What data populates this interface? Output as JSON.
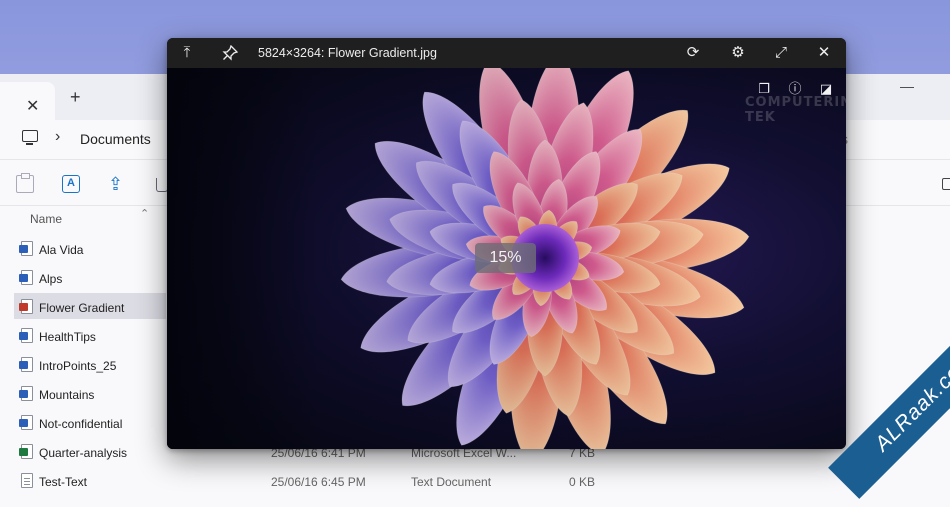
{
  "explorer": {
    "tab": {
      "close_glyph": "✕",
      "add_glyph": "+"
    },
    "window_minimize_glyph": "—",
    "breadcrumb": {
      "chevron": "›",
      "current": "Documents"
    },
    "search_ghost_text": "s",
    "toolbar": {
      "rename_glyph": "A",
      "share_glyph": "⇪"
    },
    "list": {
      "column_name": "Name",
      "sort_glyph": "⌃",
      "rows": [
        {
          "name": "Ala Vida",
          "type_icon": "word-doc-icon",
          "date": "",
          "kind": "",
          "size": ""
        },
        {
          "name": "Alps",
          "type_icon": "word-doc-icon",
          "date": "",
          "kind": "",
          "size": ""
        },
        {
          "name": "Flower Gradient",
          "type_icon": "pdf-icon",
          "date": "",
          "kind": "",
          "size": ""
        },
        {
          "name": "HealthTips",
          "type_icon": "word-doc-icon",
          "date": "",
          "kind": "",
          "size": ""
        },
        {
          "name": "IntroPoints_25",
          "type_icon": "word-doc-icon",
          "date": "",
          "kind": "",
          "size": ""
        },
        {
          "name": "Mountains",
          "type_icon": "word-doc-icon",
          "date": "",
          "kind": "",
          "size": ""
        },
        {
          "name": "Not-confidential",
          "type_icon": "word-doc-icon",
          "date": "",
          "kind": "",
          "size": ""
        },
        {
          "name": "Quarter-analysis",
          "type_icon": "excel-icon",
          "date": "25/06/16 6:41 PM",
          "kind": "Microsoft Excel W...",
          "size": "7 KB"
        },
        {
          "name": "Test-Text",
          "type_icon": "text-file-icon",
          "date": "25/06/16 6:45 PM",
          "kind": "Text Document",
          "size": "0 KB"
        }
      ],
      "selected_index": 2
    }
  },
  "viewer": {
    "title": "5824×3264: Flower Gradient.jpg",
    "buttons": {
      "scroll_top": "⤒",
      "pin": "📌",
      "rotate": "⟳",
      "settings": "⚙",
      "fullscreen": "⤢",
      "close": "✕",
      "copy": "❐",
      "info": "ⓘ",
      "more": "◪"
    },
    "zoom_level": "15%",
    "watermark": "COMPUTERING TEK"
  },
  "corner_watermark": "ALRaak.com",
  "colors": {
    "viewer_bar": "#1f1f1f",
    "ribbon": "#1b5e91",
    "selected_row": "#dcdce4",
    "accent_blue": "#1a73c8"
  }
}
